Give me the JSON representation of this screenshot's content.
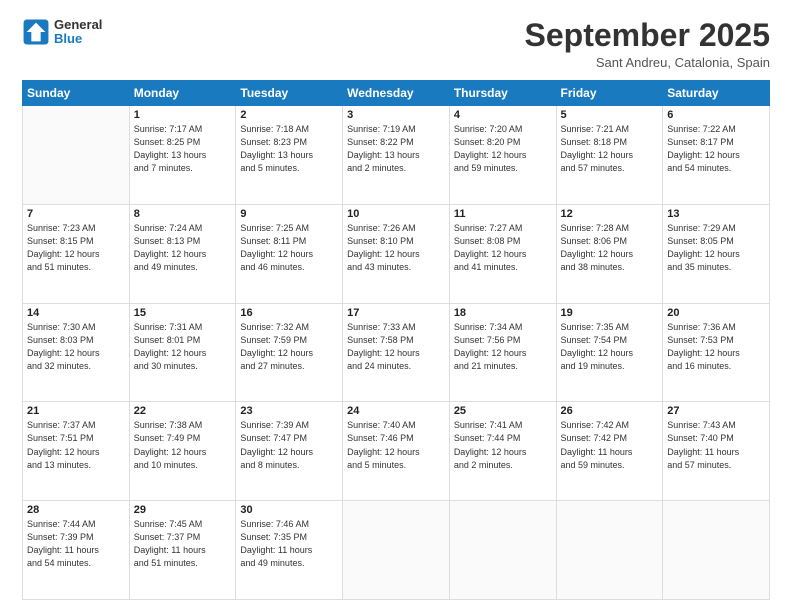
{
  "header": {
    "logo_line1": "General",
    "logo_line2": "Blue",
    "month_title": "September 2025",
    "subtitle": "Sant Andreu, Catalonia, Spain"
  },
  "weekdays": [
    "Sunday",
    "Monday",
    "Tuesday",
    "Wednesday",
    "Thursday",
    "Friday",
    "Saturday"
  ],
  "weeks": [
    [
      {
        "day": "",
        "info": ""
      },
      {
        "day": "1",
        "info": "Sunrise: 7:17 AM\nSunset: 8:25 PM\nDaylight: 13 hours\nand 7 minutes."
      },
      {
        "day": "2",
        "info": "Sunrise: 7:18 AM\nSunset: 8:23 PM\nDaylight: 13 hours\nand 5 minutes."
      },
      {
        "day": "3",
        "info": "Sunrise: 7:19 AM\nSunset: 8:22 PM\nDaylight: 13 hours\nand 2 minutes."
      },
      {
        "day": "4",
        "info": "Sunrise: 7:20 AM\nSunset: 8:20 PM\nDaylight: 12 hours\nand 59 minutes."
      },
      {
        "day": "5",
        "info": "Sunrise: 7:21 AM\nSunset: 8:18 PM\nDaylight: 12 hours\nand 57 minutes."
      },
      {
        "day": "6",
        "info": "Sunrise: 7:22 AM\nSunset: 8:17 PM\nDaylight: 12 hours\nand 54 minutes."
      }
    ],
    [
      {
        "day": "7",
        "info": "Sunrise: 7:23 AM\nSunset: 8:15 PM\nDaylight: 12 hours\nand 51 minutes."
      },
      {
        "day": "8",
        "info": "Sunrise: 7:24 AM\nSunset: 8:13 PM\nDaylight: 12 hours\nand 49 minutes."
      },
      {
        "day": "9",
        "info": "Sunrise: 7:25 AM\nSunset: 8:11 PM\nDaylight: 12 hours\nand 46 minutes."
      },
      {
        "day": "10",
        "info": "Sunrise: 7:26 AM\nSunset: 8:10 PM\nDaylight: 12 hours\nand 43 minutes."
      },
      {
        "day": "11",
        "info": "Sunrise: 7:27 AM\nSunset: 8:08 PM\nDaylight: 12 hours\nand 41 minutes."
      },
      {
        "day": "12",
        "info": "Sunrise: 7:28 AM\nSunset: 8:06 PM\nDaylight: 12 hours\nand 38 minutes."
      },
      {
        "day": "13",
        "info": "Sunrise: 7:29 AM\nSunset: 8:05 PM\nDaylight: 12 hours\nand 35 minutes."
      }
    ],
    [
      {
        "day": "14",
        "info": "Sunrise: 7:30 AM\nSunset: 8:03 PM\nDaylight: 12 hours\nand 32 minutes."
      },
      {
        "day": "15",
        "info": "Sunrise: 7:31 AM\nSunset: 8:01 PM\nDaylight: 12 hours\nand 30 minutes."
      },
      {
        "day": "16",
        "info": "Sunrise: 7:32 AM\nSunset: 7:59 PM\nDaylight: 12 hours\nand 27 minutes."
      },
      {
        "day": "17",
        "info": "Sunrise: 7:33 AM\nSunset: 7:58 PM\nDaylight: 12 hours\nand 24 minutes."
      },
      {
        "day": "18",
        "info": "Sunrise: 7:34 AM\nSunset: 7:56 PM\nDaylight: 12 hours\nand 21 minutes."
      },
      {
        "day": "19",
        "info": "Sunrise: 7:35 AM\nSunset: 7:54 PM\nDaylight: 12 hours\nand 19 minutes."
      },
      {
        "day": "20",
        "info": "Sunrise: 7:36 AM\nSunset: 7:53 PM\nDaylight: 12 hours\nand 16 minutes."
      }
    ],
    [
      {
        "day": "21",
        "info": "Sunrise: 7:37 AM\nSunset: 7:51 PM\nDaylight: 12 hours\nand 13 minutes."
      },
      {
        "day": "22",
        "info": "Sunrise: 7:38 AM\nSunset: 7:49 PM\nDaylight: 12 hours\nand 10 minutes."
      },
      {
        "day": "23",
        "info": "Sunrise: 7:39 AM\nSunset: 7:47 PM\nDaylight: 12 hours\nand 8 minutes."
      },
      {
        "day": "24",
        "info": "Sunrise: 7:40 AM\nSunset: 7:46 PM\nDaylight: 12 hours\nand 5 minutes."
      },
      {
        "day": "25",
        "info": "Sunrise: 7:41 AM\nSunset: 7:44 PM\nDaylight: 12 hours\nand 2 minutes."
      },
      {
        "day": "26",
        "info": "Sunrise: 7:42 AM\nSunset: 7:42 PM\nDaylight: 11 hours\nand 59 minutes."
      },
      {
        "day": "27",
        "info": "Sunrise: 7:43 AM\nSunset: 7:40 PM\nDaylight: 11 hours\nand 57 minutes."
      }
    ],
    [
      {
        "day": "28",
        "info": "Sunrise: 7:44 AM\nSunset: 7:39 PM\nDaylight: 11 hours\nand 54 minutes."
      },
      {
        "day": "29",
        "info": "Sunrise: 7:45 AM\nSunset: 7:37 PM\nDaylight: 11 hours\nand 51 minutes."
      },
      {
        "day": "30",
        "info": "Sunrise: 7:46 AM\nSunset: 7:35 PM\nDaylight: 11 hours\nand 49 minutes."
      },
      {
        "day": "",
        "info": ""
      },
      {
        "day": "",
        "info": ""
      },
      {
        "day": "",
        "info": ""
      },
      {
        "day": "",
        "info": ""
      }
    ]
  ]
}
